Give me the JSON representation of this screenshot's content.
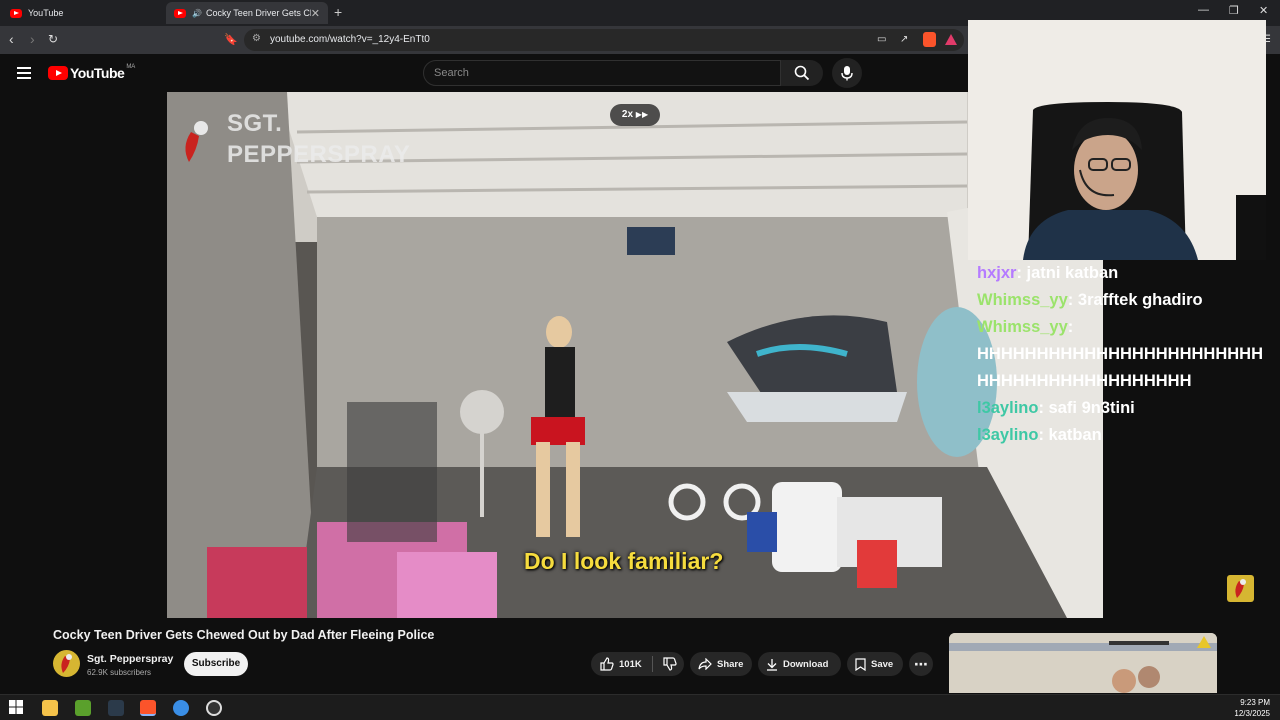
{
  "browser": {
    "tabs": [
      {
        "label": "YouTube",
        "active": false
      },
      {
        "label": "Cocky Teen Driver Gets Chew",
        "active": true
      }
    ],
    "new_tab_icon": "plus-icon",
    "url": "youtube.com/watch?v=_12y4-EnTt0",
    "window_controls": [
      "minimize-icon",
      "restore-icon",
      "close-icon"
    ]
  },
  "youtube": {
    "logo_text": "YouTube",
    "country_code": "MA",
    "search_placeholder": "Search"
  },
  "video": {
    "speed_label": "2x",
    "watermark_line1": "SGT.",
    "watermark_line2": "PEPPERSPRAY",
    "subtitle": "Do I look familiar?",
    "title": "Cocky Teen Driver Gets Chewed Out by Dad After Fleeing Police"
  },
  "channel": {
    "name": "Sgt. Pepperspray",
    "subscribers": "62.9K subscribers",
    "subscribe_label": "Subscribe"
  },
  "actions": {
    "likes": "101K",
    "share": "Share",
    "download": "Download",
    "save": "Save"
  },
  "chat": [
    {
      "user": "hxjxr",
      "message": "jatni katban",
      "color": "#b57bff"
    },
    {
      "user": "Whimss_yy",
      "message": "3rafftek ghadiro",
      "color": "#9be36b"
    },
    {
      "user": "Whimss_yy",
      "message": "HHHHHHHHHHHHHHHHHHHHHHHHHHHHHHHHHHHHHHHHHH",
      "color": "#9be36b"
    },
    {
      "user": "l3aylino",
      "message": "safi 9n3tini",
      "color": "#3ec8a5"
    },
    {
      "user": "l3aylino",
      "message": "katban",
      "color": "#3ec8a5"
    }
  ],
  "taskbar": {
    "time": "9:23 PM",
    "date": "12/3/2025"
  }
}
